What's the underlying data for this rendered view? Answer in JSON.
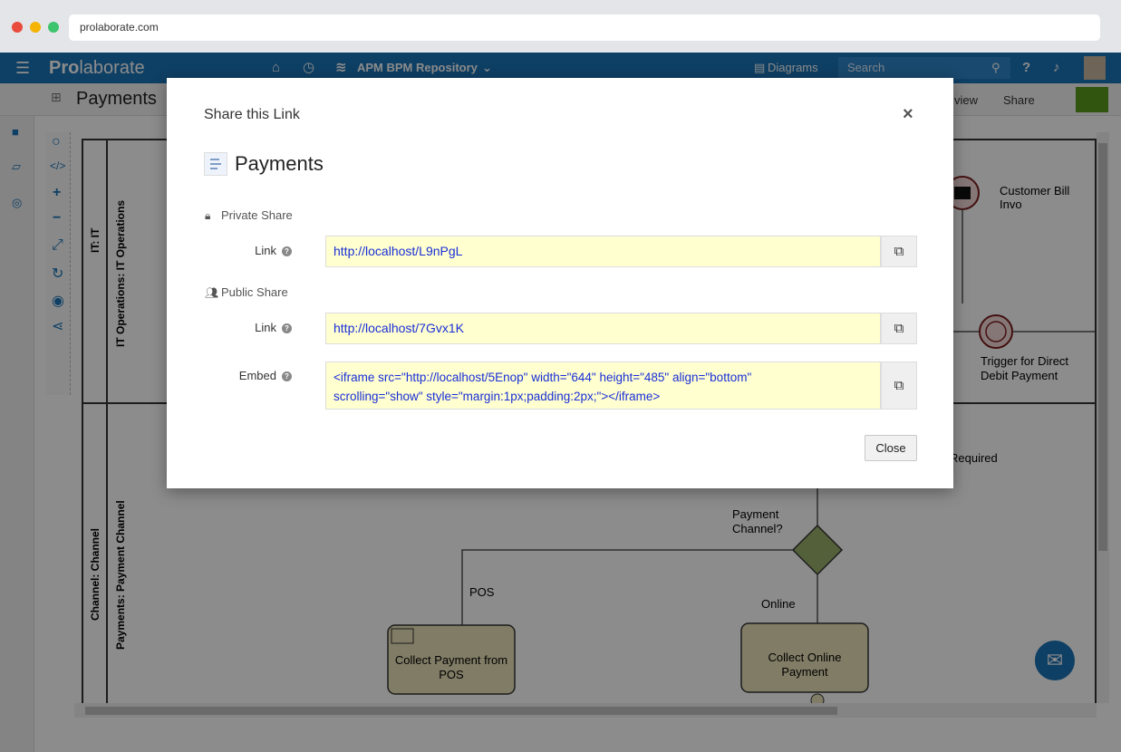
{
  "browser": {
    "url": "prolaborate.com",
    "dot_colors": [
      "#e94b3c",
      "#f4b400",
      "#3ec46d"
    ]
  },
  "app": {
    "logo_pro": "Pro",
    "logo_rest": "laborate",
    "repository": "APM BPM Repository",
    "diagrams_label": "Diagrams",
    "search_placeholder": "Search",
    "share_label": "Share",
    "view_label": "view",
    "page_title": "Payments",
    "brand_color": "#1b73b6"
  },
  "diagram": {
    "lane_it": "IT: IT",
    "lane_it_ops": "IT Operations: IT Operations",
    "lane_channel": "Channel: Channel",
    "lane_payment_channel": "Payments: Payment Channel",
    "customer_bill": "Customer Bill Invo",
    "trigger_line1": "Trigger for Direct",
    "trigger_line2": "Debit Payment",
    "required": "Required",
    "payment_channel_q_line1": "Payment",
    "payment_channel_q_line2": "Channel?",
    "pos": "POS",
    "online": "Online",
    "collect_pos_line1": "Collect Payment from",
    "collect_pos_line2": "POS",
    "collect_online_line1": "Collect Online",
    "collect_online_line2": "Payment"
  },
  "modal": {
    "title": "Share this Link",
    "doc_title": "Payments",
    "private_share": "Private Share",
    "public_share": "Public Share",
    "link_label": "Link",
    "embed_label": "Embed",
    "private_link": "http://localhost/L9nPgL",
    "public_link": "http://localhost/7Gvx1K",
    "embed_line1": "<iframe src=\"http://localhost/5Enop\" width=\"644\" height=\"485\" align=\"bottom\"",
    "embed_line2": "scrolling=\"show\" style=\"margin:1px;padding:2px;\"></iframe>",
    "close_button": "Close"
  }
}
